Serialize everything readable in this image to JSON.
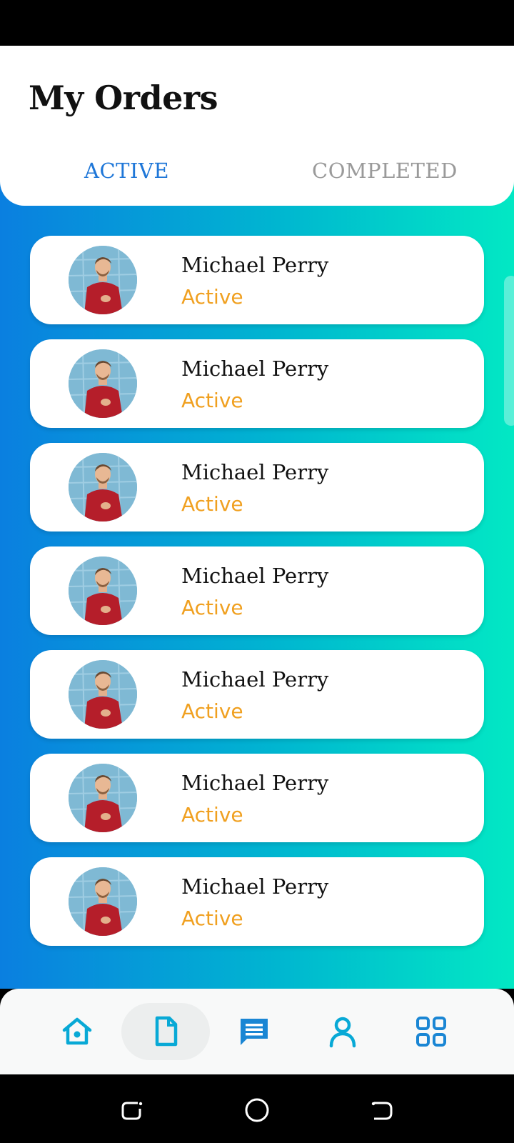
{
  "header": {
    "title": "My Orders",
    "tabs": [
      {
        "label": "ACTIVE",
        "selected": true
      },
      {
        "label": "COMPLETED",
        "selected": false
      }
    ]
  },
  "orders": [
    {
      "name": "Michael Perry",
      "status": "Active"
    },
    {
      "name": "Michael Perry",
      "status": "Active"
    },
    {
      "name": "Michael Perry",
      "status": "Active"
    },
    {
      "name": "Michael Perry",
      "status": "Active"
    },
    {
      "name": "Michael Perry",
      "status": "Active"
    },
    {
      "name": "Michael Perry",
      "status": "Active"
    },
    {
      "name": "Michael Perry",
      "status": "Active"
    }
  ],
  "bottom_nav": [
    {
      "icon": "home-icon",
      "selected": false
    },
    {
      "icon": "document-icon",
      "selected": true
    },
    {
      "icon": "chat-icon",
      "selected": false
    },
    {
      "icon": "user-icon",
      "selected": false
    },
    {
      "icon": "grid-icon",
      "selected": false
    }
  ],
  "system_nav": [
    "recent-apps-icon",
    "home-circle-icon",
    "back-icon"
  ],
  "colors": {
    "accent": "#1f77d8",
    "status_active": "#f0a020",
    "inactive_tab": "#9a9a9a",
    "gradient_start": "#0a7fe0",
    "gradient_end": "#02e8c4"
  }
}
